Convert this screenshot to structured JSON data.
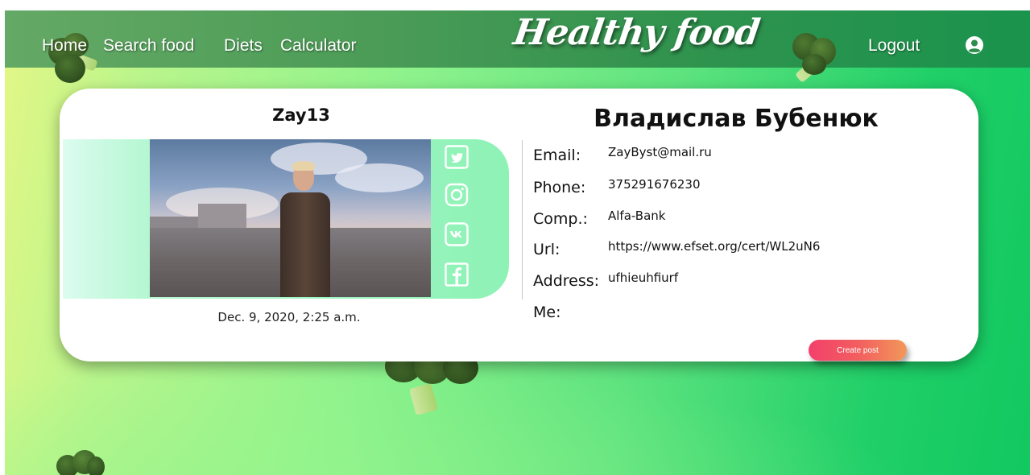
{
  "navbar": {
    "links": [
      "Home",
      "Search food",
      "Diets",
      "Calculator"
    ],
    "brand": "Healthy food",
    "logout_label": "Logout",
    "user_icon": "user-circle-icon"
  },
  "profile": {
    "username": "Zay13",
    "full_name": "Владислав Бубенюк",
    "joined": "Dec. 9, 2020, 2:25 a.m.",
    "social_icons": [
      "twitter-icon",
      "instagram-icon",
      "vk-icon",
      "facebook-icon"
    ],
    "fields": [
      {
        "label": "Email:",
        "value": "ZayByst@mail.ru"
      },
      {
        "label": "Phone:",
        "value": "375291676230"
      },
      {
        "label": "Comp.:",
        "value": "Alfa-Bank"
      },
      {
        "label": "Url:",
        "value": "https://www.efset.org/cert/WL2uN6"
      },
      {
        "label": "Address:",
        "value": "ufhieuhfiurf"
      },
      {
        "label": "Me:",
        "value": ""
      }
    ],
    "create_post_label": "Create post"
  },
  "colors": {
    "navbar": "#3d9a55",
    "button_start": "#f3406b",
    "button_end": "#f1985a",
    "social_panel": "#9cf5c2"
  }
}
